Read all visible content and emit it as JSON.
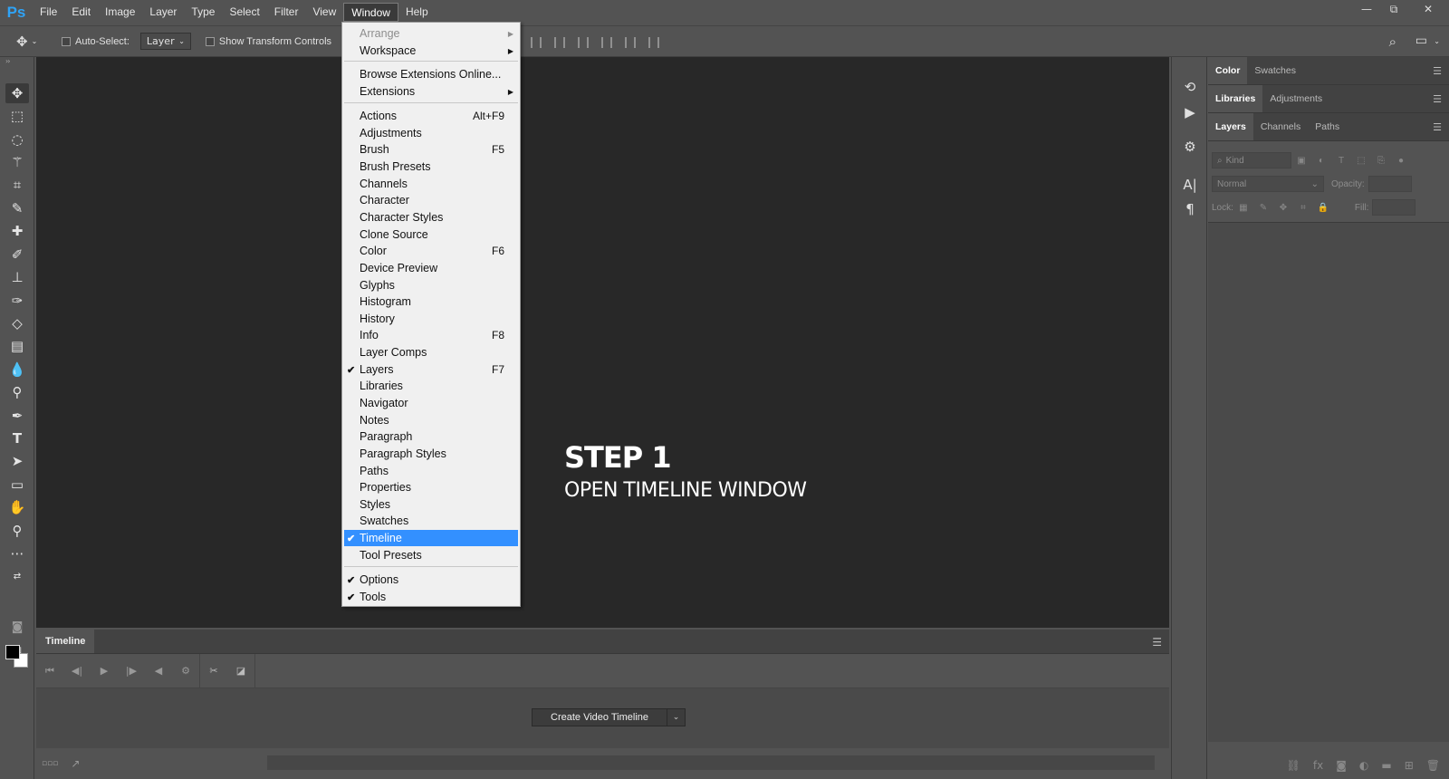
{
  "app": {
    "logo": "Ps"
  },
  "menubar": [
    "File",
    "Edit",
    "Image",
    "Layer",
    "Type",
    "Select",
    "Filter",
    "View",
    "Window",
    "Help"
  ],
  "window_controls": {
    "minimize": "—",
    "restore": "⧉",
    "close": "✕"
  },
  "options_bar": {
    "auto_select_label": "Auto-Select:",
    "auto_select_value": "Layer",
    "show_transform_label": "Show Transform Controls"
  },
  "canvas": {
    "step_title": "STEP 1",
    "step_subtitle": "OPEN TIMELINE WINDOW"
  },
  "window_menu": {
    "items": [
      {
        "label": "Arrange",
        "shortcut": "",
        "checked": false,
        "submenu": true,
        "disabled": true
      },
      {
        "label": "Workspace",
        "shortcut": "",
        "checked": false,
        "submenu": true,
        "disabled": false
      },
      {
        "label": "Browse Extensions Online...",
        "shortcut": "",
        "checked": false,
        "submenu": false,
        "disabled": false
      },
      {
        "label": "Extensions",
        "shortcut": "",
        "checked": false,
        "submenu": true,
        "disabled": false
      },
      {
        "label": "Actions",
        "shortcut": "Alt+F9",
        "checked": false,
        "submenu": false,
        "disabled": false
      },
      {
        "label": "Adjustments",
        "shortcut": "",
        "checked": false,
        "submenu": false,
        "disabled": false
      },
      {
        "label": "Brush",
        "shortcut": "F5",
        "checked": false,
        "submenu": false,
        "disabled": false
      },
      {
        "label": "Brush Presets",
        "shortcut": "",
        "checked": false,
        "submenu": false,
        "disabled": false
      },
      {
        "label": "Channels",
        "shortcut": "",
        "checked": false,
        "submenu": false,
        "disabled": false
      },
      {
        "label": "Character",
        "shortcut": "",
        "checked": false,
        "submenu": false,
        "disabled": false
      },
      {
        "label": "Character Styles",
        "shortcut": "",
        "checked": false,
        "submenu": false,
        "disabled": false
      },
      {
        "label": "Clone Source",
        "shortcut": "",
        "checked": false,
        "submenu": false,
        "disabled": false
      },
      {
        "label": "Color",
        "shortcut": "F6",
        "checked": false,
        "submenu": false,
        "disabled": false
      },
      {
        "label": "Device Preview",
        "shortcut": "",
        "checked": false,
        "submenu": false,
        "disabled": false
      },
      {
        "label": "Glyphs",
        "shortcut": "",
        "checked": false,
        "submenu": false,
        "disabled": false
      },
      {
        "label": "Histogram",
        "shortcut": "",
        "checked": false,
        "submenu": false,
        "disabled": false
      },
      {
        "label": "History",
        "shortcut": "",
        "checked": false,
        "submenu": false,
        "disabled": false
      },
      {
        "label": "Info",
        "shortcut": "F8",
        "checked": false,
        "submenu": false,
        "disabled": false
      },
      {
        "label": "Layer Comps",
        "shortcut": "",
        "checked": false,
        "submenu": false,
        "disabled": false
      },
      {
        "label": "Layers",
        "shortcut": "F7",
        "checked": true,
        "submenu": false,
        "disabled": false
      },
      {
        "label": "Libraries",
        "shortcut": "",
        "checked": false,
        "submenu": false,
        "disabled": false
      },
      {
        "label": "Navigator",
        "shortcut": "",
        "checked": false,
        "submenu": false,
        "disabled": false
      },
      {
        "label": "Notes",
        "shortcut": "",
        "checked": false,
        "submenu": false,
        "disabled": false
      },
      {
        "label": "Paragraph",
        "shortcut": "",
        "checked": false,
        "submenu": false,
        "disabled": false
      },
      {
        "label": "Paragraph Styles",
        "shortcut": "",
        "checked": false,
        "submenu": false,
        "disabled": false
      },
      {
        "label": "Paths",
        "shortcut": "",
        "checked": false,
        "submenu": false,
        "disabled": false
      },
      {
        "label": "Properties",
        "shortcut": "",
        "checked": false,
        "submenu": false,
        "disabled": false
      },
      {
        "label": "Styles",
        "shortcut": "",
        "checked": false,
        "submenu": false,
        "disabled": false
      },
      {
        "label": "Swatches",
        "shortcut": "",
        "checked": false,
        "submenu": false,
        "disabled": false
      },
      {
        "label": "Timeline",
        "shortcut": "",
        "checked": true,
        "submenu": false,
        "disabled": false,
        "highlighted": true
      },
      {
        "label": "Tool Presets",
        "shortcut": "",
        "checked": false,
        "submenu": false,
        "disabled": false
      },
      {
        "label": "Options",
        "shortcut": "",
        "checked": true,
        "submenu": false,
        "disabled": false
      },
      {
        "label": "Tools",
        "shortcut": "",
        "checked": true,
        "submenu": false,
        "disabled": false
      }
    ]
  },
  "timeline": {
    "tab_label": "Timeline",
    "create_button": "Create Video Timeline"
  },
  "panels": {
    "group1": [
      "Color",
      "Swatches"
    ],
    "group2": [
      "Libraries",
      "Adjustments"
    ],
    "group3": [
      "Layers",
      "Channels",
      "Paths"
    ],
    "layers": {
      "filter_placeholder": "Kind",
      "blend_mode": "Normal",
      "opacity_label": "Opacity:",
      "lock_label": "Lock:",
      "fill_label": "Fill:"
    }
  },
  "colors": {
    "accent": "#2fa3f6",
    "highlight": "#3390ff",
    "canvas": "#282828",
    "ui": "#535353"
  }
}
